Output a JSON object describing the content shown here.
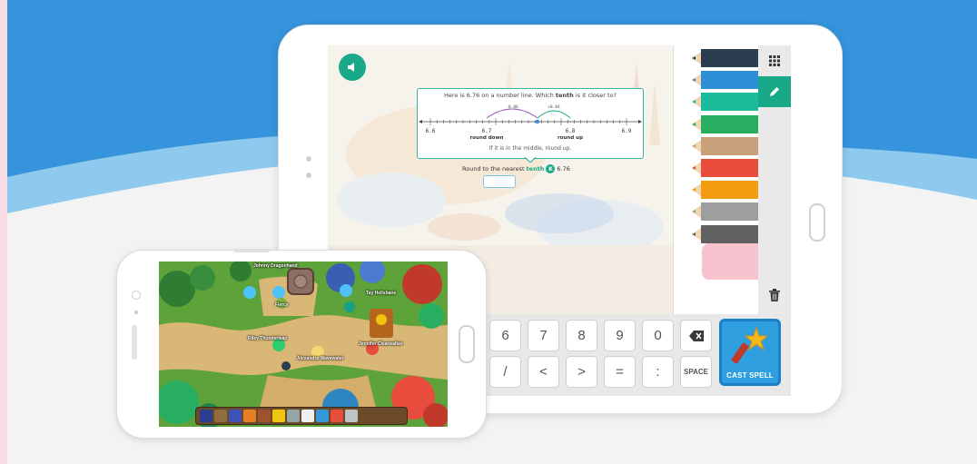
{
  "question": {
    "prefix": "Here is 6.76 on a number line. Which ",
    "emphasis": "tenth",
    "suffix": " is it closer to?",
    "left_distance": "-0.06",
    "right_distance": "+0.04",
    "ticks": [
      "6.6",
      "6.7",
      "6.8",
      "6.9"
    ],
    "round_down_label": "round down",
    "round_up_label": "round up",
    "hint": "If it is in the middle, round up."
  },
  "prompt": {
    "prefix": "Round to the nearest",
    "unit": "tenth",
    "number": "6.76"
  },
  "colors": {
    "accent": "#1aa988",
    "pencils": [
      "#2b3e50",
      "#2d8fd5",
      "#1abc9c",
      "#27ae60",
      "#c8a07a",
      "#e74c3c",
      "#f39c12",
      "#9e9e9e",
      "#616161"
    ],
    "eraser": "#f8c3cf",
    "cast_button": "#2f9fe0"
  },
  "toolbar": {
    "grid_icon": "grid-icon",
    "pencil_icon": "pencil-icon",
    "trash_icon": "trash-icon"
  },
  "keypad": {
    "row1": [
      "6",
      "7",
      "8",
      "9",
      "0"
    ],
    "row2": [
      "/",
      "<",
      ">",
      "=",
      ":"
    ],
    "backspace_icon": "backspace-icon",
    "space_label": "SPACE",
    "cast_label": "CAST SPELL"
  },
  "game": {
    "players": [
      "Johnny Dragonhand",
      "Fierce",
      "Tay Hellsbane",
      "Riley Thunderleap",
      "Alexandra Wavewater",
      "Jennifer Clearwalker"
    ],
    "hotbar_icons": [
      "map-icon",
      "backpack-icon",
      "book-icon",
      "pet-icon",
      "bag-icon",
      "trophy-icon",
      "gear-icon",
      "chat-icon",
      "friends-icon",
      "house-icon",
      "mail-icon"
    ]
  }
}
